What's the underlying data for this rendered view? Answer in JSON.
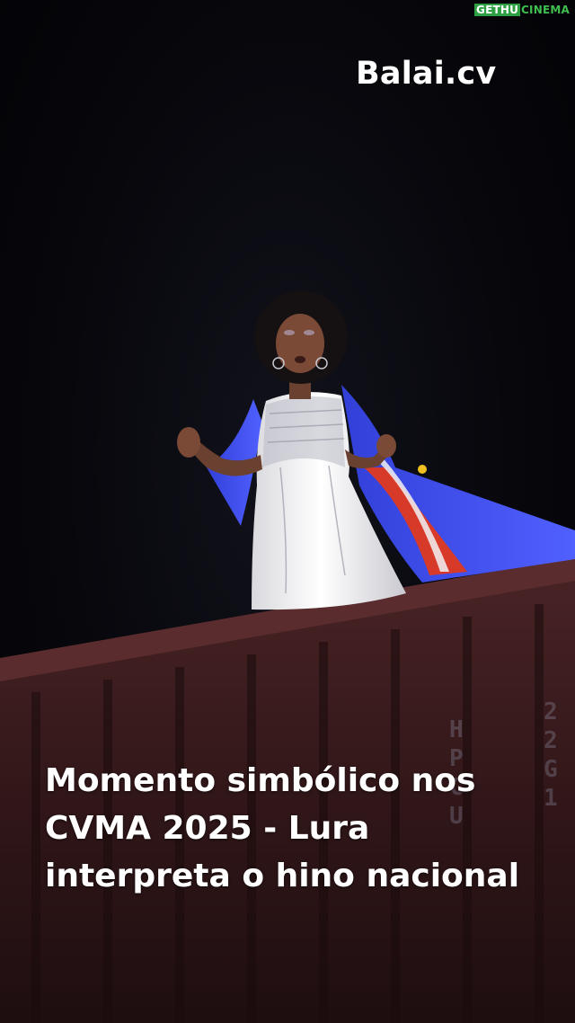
{
  "watermark": {
    "part1": "GETHU",
    "part2": "CINEMA"
  },
  "brand": {
    "label": "Balai.cv"
  },
  "caption": {
    "lines": [
      "Momento simbólico nos",
      "CVMA 2025 - Lura",
      "interpreta o hino nacional"
    ]
  },
  "colors": {
    "background": "#05050a",
    "flag_blue": "#2f3fd0",
    "flag_red": "#d83a2a",
    "dress": "#f2f2f4",
    "container": "#3a1a1c"
  }
}
